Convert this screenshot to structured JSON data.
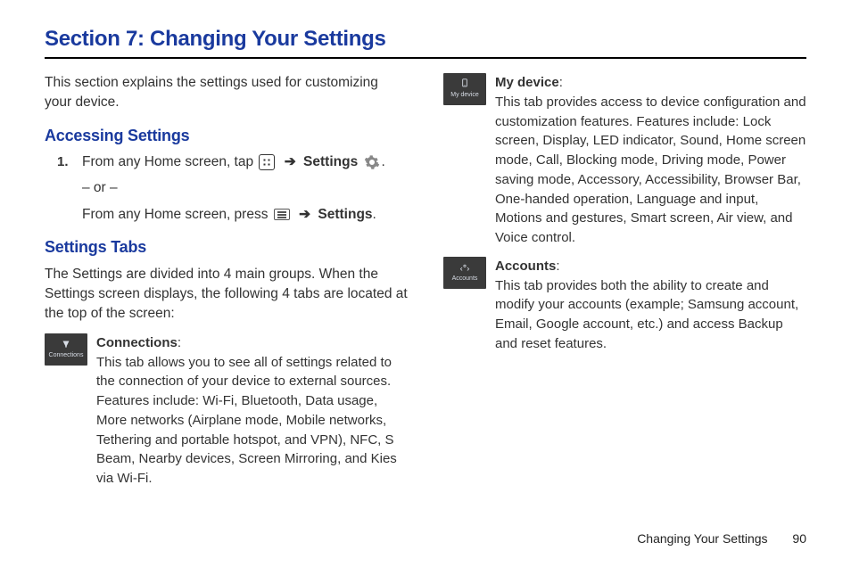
{
  "title": "Section 7: Changing Your Settings",
  "intro": "This section explains the settings used for customizing your device.",
  "accessing": {
    "heading": "Accessing Settings",
    "step_num": "1.",
    "step_line1_a": "From any Home screen, tap ",
    "step_line1_settings": "Settings",
    "step_line1_end": ".",
    "or": "– or –",
    "step_line2_a": "From any Home screen, press ",
    "step_line2_settings": "Settings",
    "step_line2_end": "."
  },
  "tabs": {
    "heading": "Settings Tabs",
    "intro": "The Settings are divided into 4 main groups. When the Settings screen displays, the following 4 tabs are located at the top of the screen:",
    "connections": {
      "icon_label": "Connections",
      "name": "Connections",
      "colon": ":",
      "desc": "This tab allows you to see all of settings related to the connection of your device to external sources. Features include: Wi-Fi, Bluetooth, Data usage, More networks (Airplane mode, Mobile networks, Tethering and portable hotspot, and VPN), NFC, S Beam, Nearby devices, Screen Mirroring, and Kies via Wi-Fi."
    },
    "mydevice": {
      "icon_label": "My device",
      "name": "My device",
      "colon": ":",
      "desc": "This tab provides access to device configuration and customization features. Features include: Lock screen, Display, LED indicator, Sound, Home screen mode, Call, Blocking mode, Driving mode, Power saving mode, Accessory, Accessibility, Browser Bar, One-handed operation, Language and input, Motions and gestures, Smart screen, Air view, and Voice control."
    },
    "accounts": {
      "icon_label": "Accounts",
      "name": "Accounts",
      "colon": ":",
      "desc": "This tab provides both the ability to create and modify your accounts (example; Samsung account, Email, Google account, etc.) and access Backup and reset features."
    }
  },
  "footer": {
    "label": "Changing Your Settings",
    "page": "90"
  }
}
